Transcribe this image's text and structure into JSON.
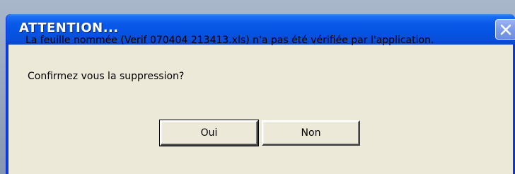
{
  "dialog": {
    "title": "ATTENTION...",
    "message": "La feuille nommée (Verif 070404 213413.xls) n'a pas été vérifiée par l'application.",
    "question": "Confirmez vous la suppression?",
    "buttons": {
      "yes_label": "Oui",
      "no_label": "Non"
    },
    "close_icon": "close-icon"
  },
  "colors": {
    "titlebar": "#0553e3",
    "client_background": "#ece9d8",
    "title_text": "#ffffff"
  }
}
